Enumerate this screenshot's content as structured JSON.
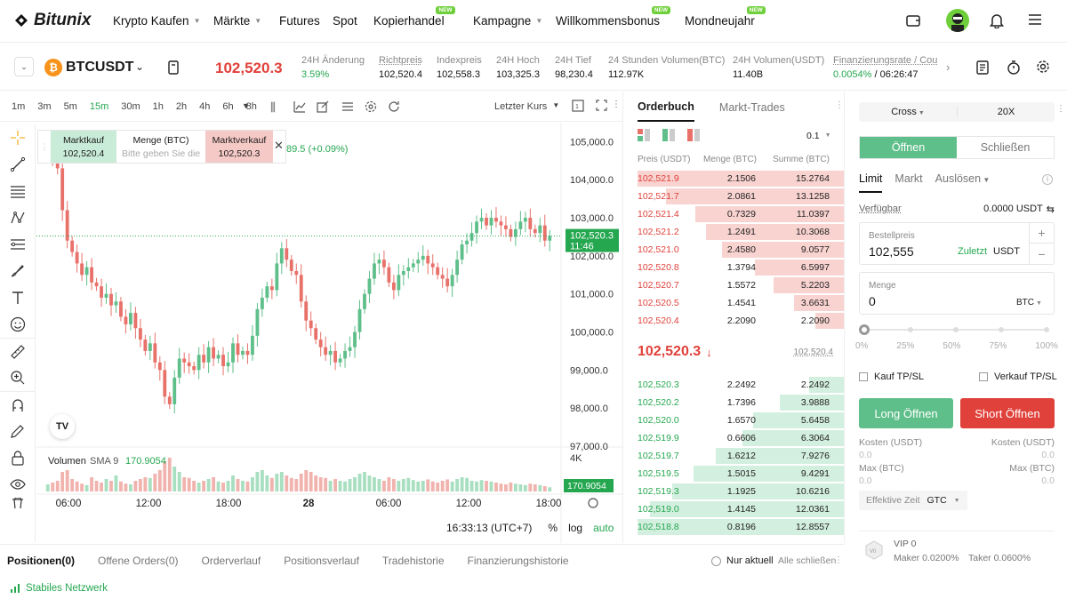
{
  "nav": {
    "logo": "Bitunix",
    "items": [
      {
        "label": "Krypto Kaufen",
        "caret": true,
        "new": false
      },
      {
        "label": "Märkte",
        "caret": true,
        "new": false
      },
      {
        "label": "Futures",
        "caret": false,
        "new": false
      },
      {
        "label": "Spot",
        "caret": false,
        "new": false
      },
      {
        "label": "Kopierhandel",
        "caret": false,
        "new": true
      },
      {
        "label": "Kampagne",
        "caret": true,
        "new": false
      },
      {
        "label": "Willkommensbonus",
        "caret": false,
        "new": true
      },
      {
        "label": "Mondneujahr",
        "caret": false,
        "new": true
      }
    ],
    "new_badge": "NEW"
  },
  "ticker": {
    "symbol": "BTCUSDT",
    "last_price": "102,520.3",
    "stats": [
      {
        "label": "24H Änderung",
        "value": "3.59%"
      },
      {
        "label": "Richtpreis",
        "value": "102,520.4"
      },
      {
        "label": "Indexpreis",
        "value": "102,558.3"
      },
      {
        "label": "24H Hoch",
        "value": "103,325.3"
      },
      {
        "label": "24H Tief",
        "value": "98,230.4"
      },
      {
        "label": "24 Stunden Volumen(BTC)",
        "value": "112.97K"
      },
      {
        "label": "24H Volumen(USDT)",
        "value": "11.40B"
      }
    ],
    "funding_label": "Finanzierungsrate / Coun",
    "funding_rate": "0.0054%",
    "funding_countdown": "/ 06:26:47"
  },
  "chart_toolbar": {
    "timeframes": [
      "1m",
      "3m",
      "5m",
      "15m",
      "30m",
      "1h",
      "2h",
      "4h",
      "6h",
      "8h"
    ],
    "active_timeframe": "15m",
    "price_source": "Letzter Kurs"
  },
  "quick_trade": {
    "buy_label": "Marktkauf",
    "buy_price": "102,520.4",
    "qty_label": "Menge (BTC)",
    "qty_placeholder": "Bitte geben Sie die",
    "sell_label": "Marktverkauf",
    "sell_price": "102,520.3",
    "change_text": "89.5 (+0.09%)"
  },
  "chart_data": {
    "type": "candlestick",
    "y_ticks": [
      "105,000.0",
      "104,000.0",
      "103,000.0",
      "102,000.0",
      "101,000.0",
      "100,000.0",
      "99,000.0",
      "98,000.0",
      "97,000.0"
    ],
    "y_range": [
      97000,
      105500
    ],
    "x_ticks": [
      "06:00",
      "12:00",
      "18:00",
      "28",
      "06:00",
      "12:00",
      "18:00"
    ],
    "last_price_label": "102,520.3",
    "last_price_countdown": "11:46",
    "last_price": 102520.3,
    "volume_label": "Volumen",
    "volume_sma_label": "SMA 9",
    "volume_sma_value": "170.9054",
    "volume_axis_tick": "4K",
    "volume_last_label": "170.9054",
    "closes": [
      104800,
      104600,
      104300,
      103200,
      102400,
      102100,
      101800,
      101500,
      101700,
      101300,
      101200,
      100900,
      101000,
      100700,
      100800,
      100400,
      100200,
      100500,
      100100,
      99800,
      99500,
      99700,
      99200,
      99000,
      98300,
      98100,
      98800,
      99300,
      99200,
      99100,
      99000,
      99400,
      99200,
      99600,
      99300,
      99400,
      99100,
      99200,
      99700,
      99400,
      99500,
      99400,
      99900,
      100600,
      100900,
      101200,
      101100,
      101800,
      102200,
      101900,
      101600,
      101500,
      100800,
      100300,
      100100,
      99800,
      99600,
      99400,
      99500,
      99200,
      99300,
      99500,
      99600,
      100000,
      100600,
      101000,
      101400,
      101800,
      101900,
      101700,
      101300,
      101100,
      101500,
      101600,
      101700,
      101800,
      101900,
      102000,
      101800,
      101700,
      101500,
      101400,
      101200,
      101500,
      101900,
      102300,
      102400,
      102600,
      102900,
      103000,
      102800,
      103000,
      102900,
      102800,
      102700,
      102500,
      102700,
      102900,
      103000,
      102700,
      102600,
      102800,
      102400,
      102520
    ],
    "volumes": [
      20,
      25,
      30,
      55,
      60,
      35,
      28,
      22,
      18,
      40,
      30,
      25,
      35,
      30,
      45,
      28,
      22,
      20,
      30,
      35,
      40,
      38,
      50,
      60,
      85,
      95,
      70,
      55,
      40,
      38,
      30,
      25,
      30,
      35,
      40,
      28,
      25,
      30,
      45,
      35,
      30,
      28,
      40,
      55,
      60,
      45,
      38,
      50,
      55,
      45,
      38,
      35,
      50,
      60,
      55,
      45,
      40,
      38,
      30,
      35,
      30,
      28,
      35,
      40,
      50,
      55,
      45,
      40,
      35,
      30,
      40,
      35,
      30,
      35,
      38,
      32,
      28,
      30,
      34,
      28,
      25,
      30,
      34,
      28,
      35,
      40,
      38,
      30,
      28,
      32,
      30,
      28,
      25,
      22,
      20,
      25,
      22,
      20,
      18,
      22,
      20,
      18,
      15,
      12
    ]
  },
  "chart_footer": {
    "time": "16:33:13 (UTC+7)",
    "percent": "%",
    "log": "log",
    "auto": "auto"
  },
  "orderbook": {
    "tabs": [
      "Orderbuch",
      "Markt-Trades"
    ],
    "precision": "0.1",
    "headers": [
      "Preis (USDT)",
      "Menge (BTC)",
      "Summe (BTC)"
    ],
    "asks": [
      {
        "price": "102,521.9",
        "qty": "2.1506",
        "sum": "15.2764",
        "depth": 1.0
      },
      {
        "price": "102,521.7",
        "qty": "2.0861",
        "sum": "13.1258",
        "depth": 0.86
      },
      {
        "price": "102,521.4",
        "qty": "0.7329",
        "sum": "11.0397",
        "depth": 0.72
      },
      {
        "price": "102,521.2",
        "qty": "1.2491",
        "sum": "10.3068",
        "depth": 0.67
      },
      {
        "price": "102,521.0",
        "qty": "2.4580",
        "sum": "9.0577",
        "depth": 0.59
      },
      {
        "price": "102,520.8",
        "qty": "1.3794",
        "sum": "6.5997",
        "depth": 0.43
      },
      {
        "price": "102,520.7",
        "qty": "1.5572",
        "sum": "5.2203",
        "depth": 0.34
      },
      {
        "price": "102,520.5",
        "qty": "1.4541",
        "sum": "3.6631",
        "depth": 0.24
      },
      {
        "price": "102,520.4",
        "qty": "2.2090",
        "sum": "2.2090",
        "depth": 0.14
      }
    ],
    "mid_price": "102,520.3",
    "mark_price": "102,520.4",
    "bids": [
      {
        "price": "102,520.3",
        "qty": "2.2492",
        "sum": "2.2492",
        "depth": 0.17
      },
      {
        "price": "102,520.2",
        "qty": "1.7396",
        "sum": "3.9888",
        "depth": 0.31
      },
      {
        "price": "102,520.0",
        "qty": "1.6570",
        "sum": "5.6458",
        "depth": 0.44
      },
      {
        "price": "102,519.9",
        "qty": "0.6606",
        "sum": "6.3064",
        "depth": 0.49
      },
      {
        "price": "102,519.7",
        "qty": "1.6212",
        "sum": "7.9276",
        "depth": 0.62
      },
      {
        "price": "102,519.5",
        "qty": "1.5015",
        "sum": "9.4291",
        "depth": 0.73
      },
      {
        "price": "102,519.3",
        "qty": "1.1925",
        "sum": "10.6216",
        "depth": 0.83
      },
      {
        "price": "102,519.0",
        "qty": "1.4145",
        "sum": "12.0361",
        "depth": 0.94
      },
      {
        "price": "102,518.8",
        "qty": "0.8196",
        "sum": "12.8557",
        "depth": 1.0
      }
    ]
  },
  "order_panel": {
    "margin_mode": "Cross",
    "leverage": "20X",
    "open_label": "Öffnen",
    "close_label": "Schließen",
    "order_types": [
      "Limit",
      "Markt",
      "Auslösen"
    ],
    "available_label": "Verfügbar",
    "available_value": "0.0000 USDT",
    "order_price_label": "Bestellpreis",
    "order_price": "102,555",
    "latest_label": "Zuletzt",
    "price_unit": "USDT",
    "qty_label": "Menge",
    "qty_value": "0",
    "qty_unit": "BTC",
    "slider_marks": [
      "0%",
      "25%",
      "50%",
      "75%",
      "100%"
    ],
    "slider_value": 0,
    "buy_tpsl": "Kauf TP/SL",
    "sell_tpsl": "Verkauf TP/SL",
    "long_label": "Long Öffnen",
    "short_label": "Short Öffnen",
    "cost_label": "Kosten (USDT)",
    "cost_value": "0.0",
    "max_label": "Max (BTC)",
    "max_value": "0.0",
    "tif_label": "Effektive Zeit",
    "tif_value": "GTC",
    "vip_level": "VIP 0",
    "maker_fee": "Maker 0.0200%",
    "taker_fee": "Taker 0.0600%"
  },
  "bottom_tabs": {
    "tabs": [
      "Positionen(0)",
      "Offene Orders(0)",
      "Orderverlauf",
      "Positionsverlauf",
      "Tradehistorie",
      "Finanzierungshistorie"
    ],
    "only_current": "Nur aktuell",
    "close_all": "Alle schließen"
  },
  "status": {
    "network": "Stabiles Netzwerk"
  },
  "colors": {
    "up": "#5fbf8a",
    "down": "#e8716a",
    "accent_green": "#25a750",
    "accent_red": "#e0413a"
  }
}
